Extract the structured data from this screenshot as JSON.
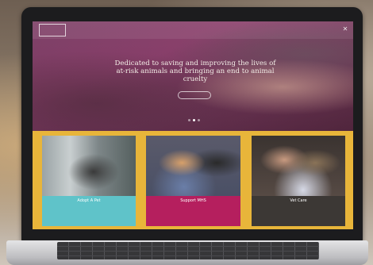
{
  "site": {
    "logo_text": ""
  },
  "hero": {
    "heading": "Dedicated to saving and improving the lives of at-risk animals and bringing an end to animal cruelty",
    "button_label": "",
    "slide_count": 3,
    "active_slide": 2
  },
  "cards": [
    {
      "title": "Adopt A Pet",
      "text": "",
      "accent": "#5fc3c9"
    },
    {
      "title": "Support MHS",
      "text": "",
      "accent": "#b51f5e"
    },
    {
      "title": "Vet Care",
      "text": "",
      "accent": "#3c3835"
    }
  ],
  "colors": {
    "cards_background": "#e8b53a",
    "hero_tint": "#9b4a78"
  }
}
